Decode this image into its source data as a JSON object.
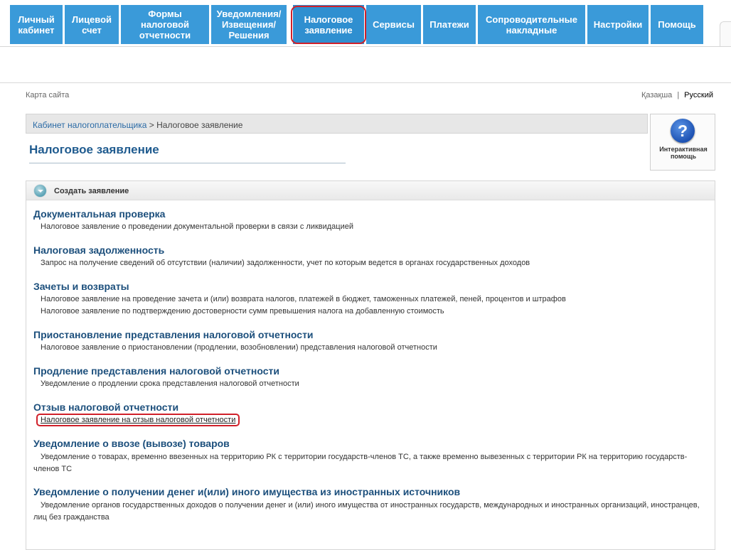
{
  "nav": {
    "items": [
      {
        "label": "Личный\nкабинет"
      },
      {
        "label": "Лицевой\nсчет"
      },
      {
        "label": "Формы\nналоговой\nотчетности"
      },
      {
        "label": "Уведомления/\nИзвещения/\nРешения"
      },
      {
        "label": "Налоговое\nзаявление"
      },
      {
        "label": "Сервисы"
      },
      {
        "label": "Платежи"
      },
      {
        "label": "Сопроводительные\nнакладные"
      },
      {
        "label": "Настройки"
      },
      {
        "label": "Помощь"
      }
    ]
  },
  "topbar": {
    "sitemap": "Карта сайта",
    "lang_kz": "Қазақша",
    "lang_sep": "|",
    "lang_ru": "Русский"
  },
  "breadcrumb": {
    "root": "Кабинет налогоплательщика",
    "sep": " > ",
    "current": "Налоговое заявление"
  },
  "page_title": "Налоговое заявление",
  "help": {
    "icon": "?",
    "label": "Интерактивная\nпомощь"
  },
  "panel": {
    "title": "Создать заявление",
    "sections": [
      {
        "title": "Документальная проверка",
        "links": [
          "Налоговое заявление о проведении документальной проверки в связи с ликвидацией"
        ]
      },
      {
        "title": "Налоговая задолженность",
        "links": [
          "Запрос на получение сведений об отсутствии (наличии) задолженности, учет по которым ведется в органах государственных доходов"
        ]
      },
      {
        "title": "Зачеты и возвраты",
        "links": [
          "Налоговое заявление на проведение зачета и (или) возврата налогов, платежей в бюджет, таможенных платежей, пеней, процентов и штрафов",
          "Налоговое заявление по подтверждению достоверности сумм превышения налога на добавленную стоимость"
        ]
      },
      {
        "title": "Приостановление представления налоговой отчетности",
        "links": [
          "Налоговое заявление о приостановлении (продлении, возобновлении) представления налоговой отчетности"
        ]
      },
      {
        "title": "Продление представления налоговой отчетности",
        "links": [
          "Уведомление о продлении срока представления налоговой отчетности"
        ]
      },
      {
        "title": "Отзыв налоговой отчетности",
        "links": [
          "Налоговое заявление на отзыв налоговой отчетности"
        ]
      },
      {
        "title": "Уведомление о ввозе (вывозе) товаров",
        "links": [
          "Уведомление о товарах, временно ввезенных на территорию РК с территории государств-членов ТС, а также временно вывезенных с территории РК на территорию государств-членов ТС"
        ]
      },
      {
        "title": "Уведомление о получении денег и(или) иного имущества из иностранных источников",
        "links": [
          "Уведомление органов государственных доходов о получении денег и (или) иного имущества от иностранных государств, международных и иностранных организаций, иностранцев, лиц без гражданства"
        ]
      }
    ]
  }
}
